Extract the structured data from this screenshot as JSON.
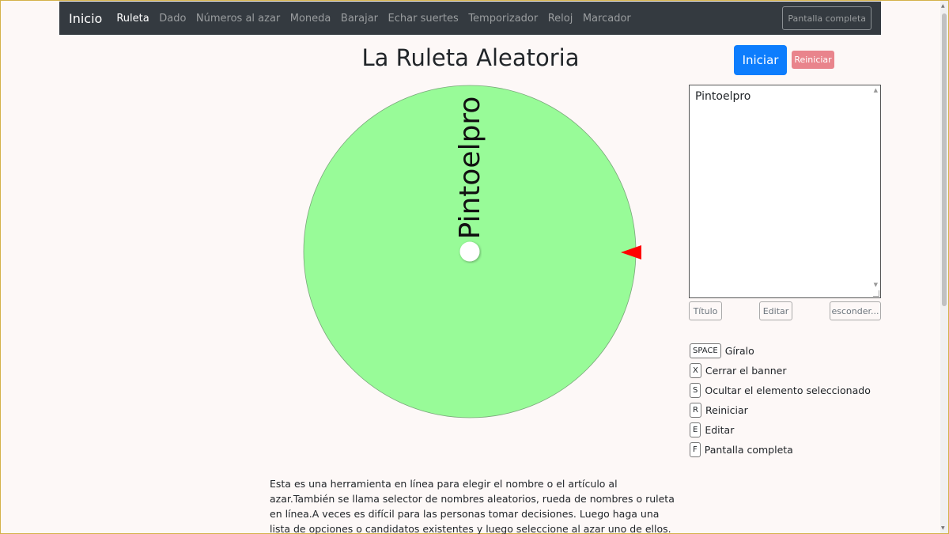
{
  "navbar": {
    "brand": "Inicio",
    "items": [
      {
        "label": "Ruleta",
        "active": true
      },
      {
        "label": "Dado",
        "active": false
      },
      {
        "label": "Números al azar",
        "active": false
      },
      {
        "label": "Moneda",
        "active": false
      },
      {
        "label": "Barajar",
        "active": false
      },
      {
        "label": "Echar suertes",
        "active": false
      },
      {
        "label": "Temporizador",
        "active": false
      },
      {
        "label": "Reloj",
        "active": false
      },
      {
        "label": "Marcador",
        "active": false
      }
    ],
    "fullscreen_label": "Pantalla completa"
  },
  "page": {
    "title": "La Ruleta Aleatoria"
  },
  "wheel": {
    "segment_label": "Pintoelpro",
    "segment_color": "#98fb98",
    "pointer_color": "#ff0000"
  },
  "controls": {
    "start_label": "Iniciar",
    "reset_label": "Reiniciar",
    "entries_text": "Pintoelpro",
    "title_button": "Título",
    "edit_button": "Editar",
    "hide_button": "esconder..."
  },
  "shortcuts": [
    {
      "key": "SPACE",
      "label": "Gíralo"
    },
    {
      "key": "X",
      "label": "Cerrar el banner"
    },
    {
      "key": "S",
      "label": "Ocultar el elemento seleccionado"
    },
    {
      "key": "R",
      "label": "Reiniciar"
    },
    {
      "key": "E",
      "label": "Editar"
    },
    {
      "key": "F",
      "label": "Pantalla completa"
    }
  ],
  "description": "Esta es una herramienta en línea para elegir el nombre o el artículo al azar.También se llama selector de nombres aleatorios, rueda de nombres o ruleta en línea.A veces es difícil para las personas tomar decisiones. Luego haga una lista de opciones o candidatos existentes y luego seleccione al azar uno de ellos. En este caso, puede utilizar nuestra herramienta para"
}
